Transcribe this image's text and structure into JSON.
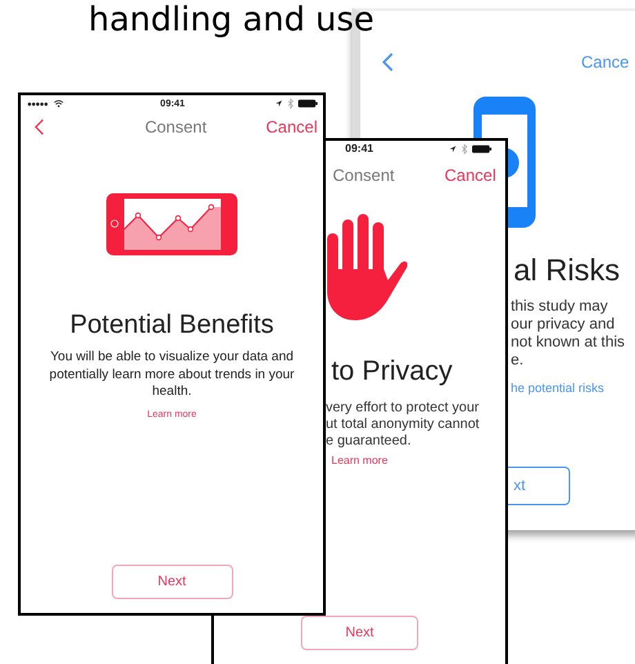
{
  "slide_title": "handling and use",
  "back_screen": {
    "cancel": "Cance",
    "title": "al Risks",
    "body": [
      "this study may",
      "our privacy and",
      "not known at this",
      "e."
    ],
    "link": "he potential risks",
    "button": "xt"
  },
  "middle_screen": {
    "time": "09:41",
    "nav_title": "Consent",
    "cancel": "Cancel",
    "title": "to Privacy",
    "body": [
      "very effort to protect your",
      "ut total anonymity cannot",
      "e guaranteed."
    ],
    "link": "Learn more",
    "button": "Next"
  },
  "front_screen": {
    "time": "09:41",
    "nav_title": "Consent",
    "cancel": "Cancel",
    "title": "Potential Benefits",
    "body": "You will be able to visualize your data and potentially learn more about trends in your health.",
    "link": "Learn more",
    "button": "Next"
  }
}
